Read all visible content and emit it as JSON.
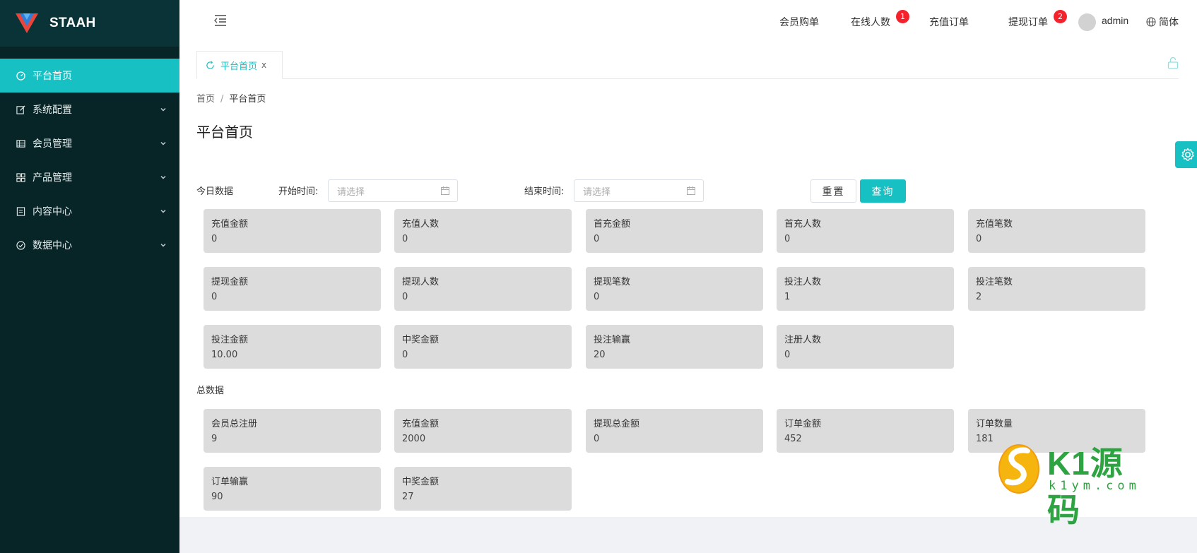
{
  "brand": {
    "name": "STAAH"
  },
  "sidebar": {
    "items": [
      {
        "label": "平台首页",
        "icon": "dashboard-icon",
        "active": true
      },
      {
        "label": "系统配置",
        "icon": "edit-icon"
      },
      {
        "label": "会员管理",
        "icon": "table-icon"
      },
      {
        "label": "产品管理",
        "icon": "grid-icon"
      },
      {
        "label": "内容中心",
        "icon": "doc-icon"
      },
      {
        "label": "数据中心",
        "icon": "check-circle-icon"
      }
    ]
  },
  "header": {
    "member_orders": "会员购单",
    "online_users": "在线人数",
    "online_badge": "1",
    "recharge_orders": "充值订单",
    "withdraw_orders": "提现订单",
    "withdraw_badge": "2",
    "user": "admin",
    "language": "简体"
  },
  "tabs": [
    {
      "label": "平台首页",
      "close": "x"
    }
  ],
  "breadcrumb": {
    "home": "首页",
    "sep": "/",
    "current": "平台首页"
  },
  "page_title": "平台首页",
  "filter": {
    "section_label": "今日数据",
    "start_label": "开始时间:",
    "start_placeholder": "请选择",
    "end_label": "结束时间:",
    "end_placeholder": "请选择",
    "reset": "重置",
    "query": "查询"
  },
  "today_stats": [
    {
      "label": "充值金额",
      "value": "0"
    },
    {
      "label": "充值人数",
      "value": "0"
    },
    {
      "label": "首充金额",
      "value": "0"
    },
    {
      "label": "首充人数",
      "value": "0"
    },
    {
      "label": "充值笔数",
      "value": "0"
    },
    {
      "label": "提现金额",
      "value": "0"
    },
    {
      "label": "提现人数",
      "value": "0"
    },
    {
      "label": "提现笔数",
      "value": "0"
    },
    {
      "label": "投注人数",
      "value": "1"
    },
    {
      "label": "投注笔数",
      "value": "2"
    },
    {
      "label": "投注金额",
      "value": "10.00"
    },
    {
      "label": "中奖金额",
      "value": "0"
    },
    {
      "label": "投注输赢",
      "value": "20"
    },
    {
      "label": "注册人数",
      "value": "0"
    }
  ],
  "total_label": "总数据",
  "total_stats": [
    {
      "label": "会员总注册",
      "value": "9"
    },
    {
      "label": "充值金额",
      "value": "2000"
    },
    {
      "label": "提现总金额",
      "value": "0"
    },
    {
      "label": "订单金额",
      "value": "452"
    },
    {
      "label": "订单数量",
      "value": "181"
    },
    {
      "label": "订单输赢",
      "value": "90"
    },
    {
      "label": "中奖金额",
      "value": "27"
    }
  ],
  "watermark": {
    "text": "K1源码",
    "domain": "k1ym.com"
  },
  "colors": {
    "accent": "#17c0c3",
    "sidebar": "#072427",
    "badge": "#f5222d",
    "card": "#dcdcdc"
  }
}
